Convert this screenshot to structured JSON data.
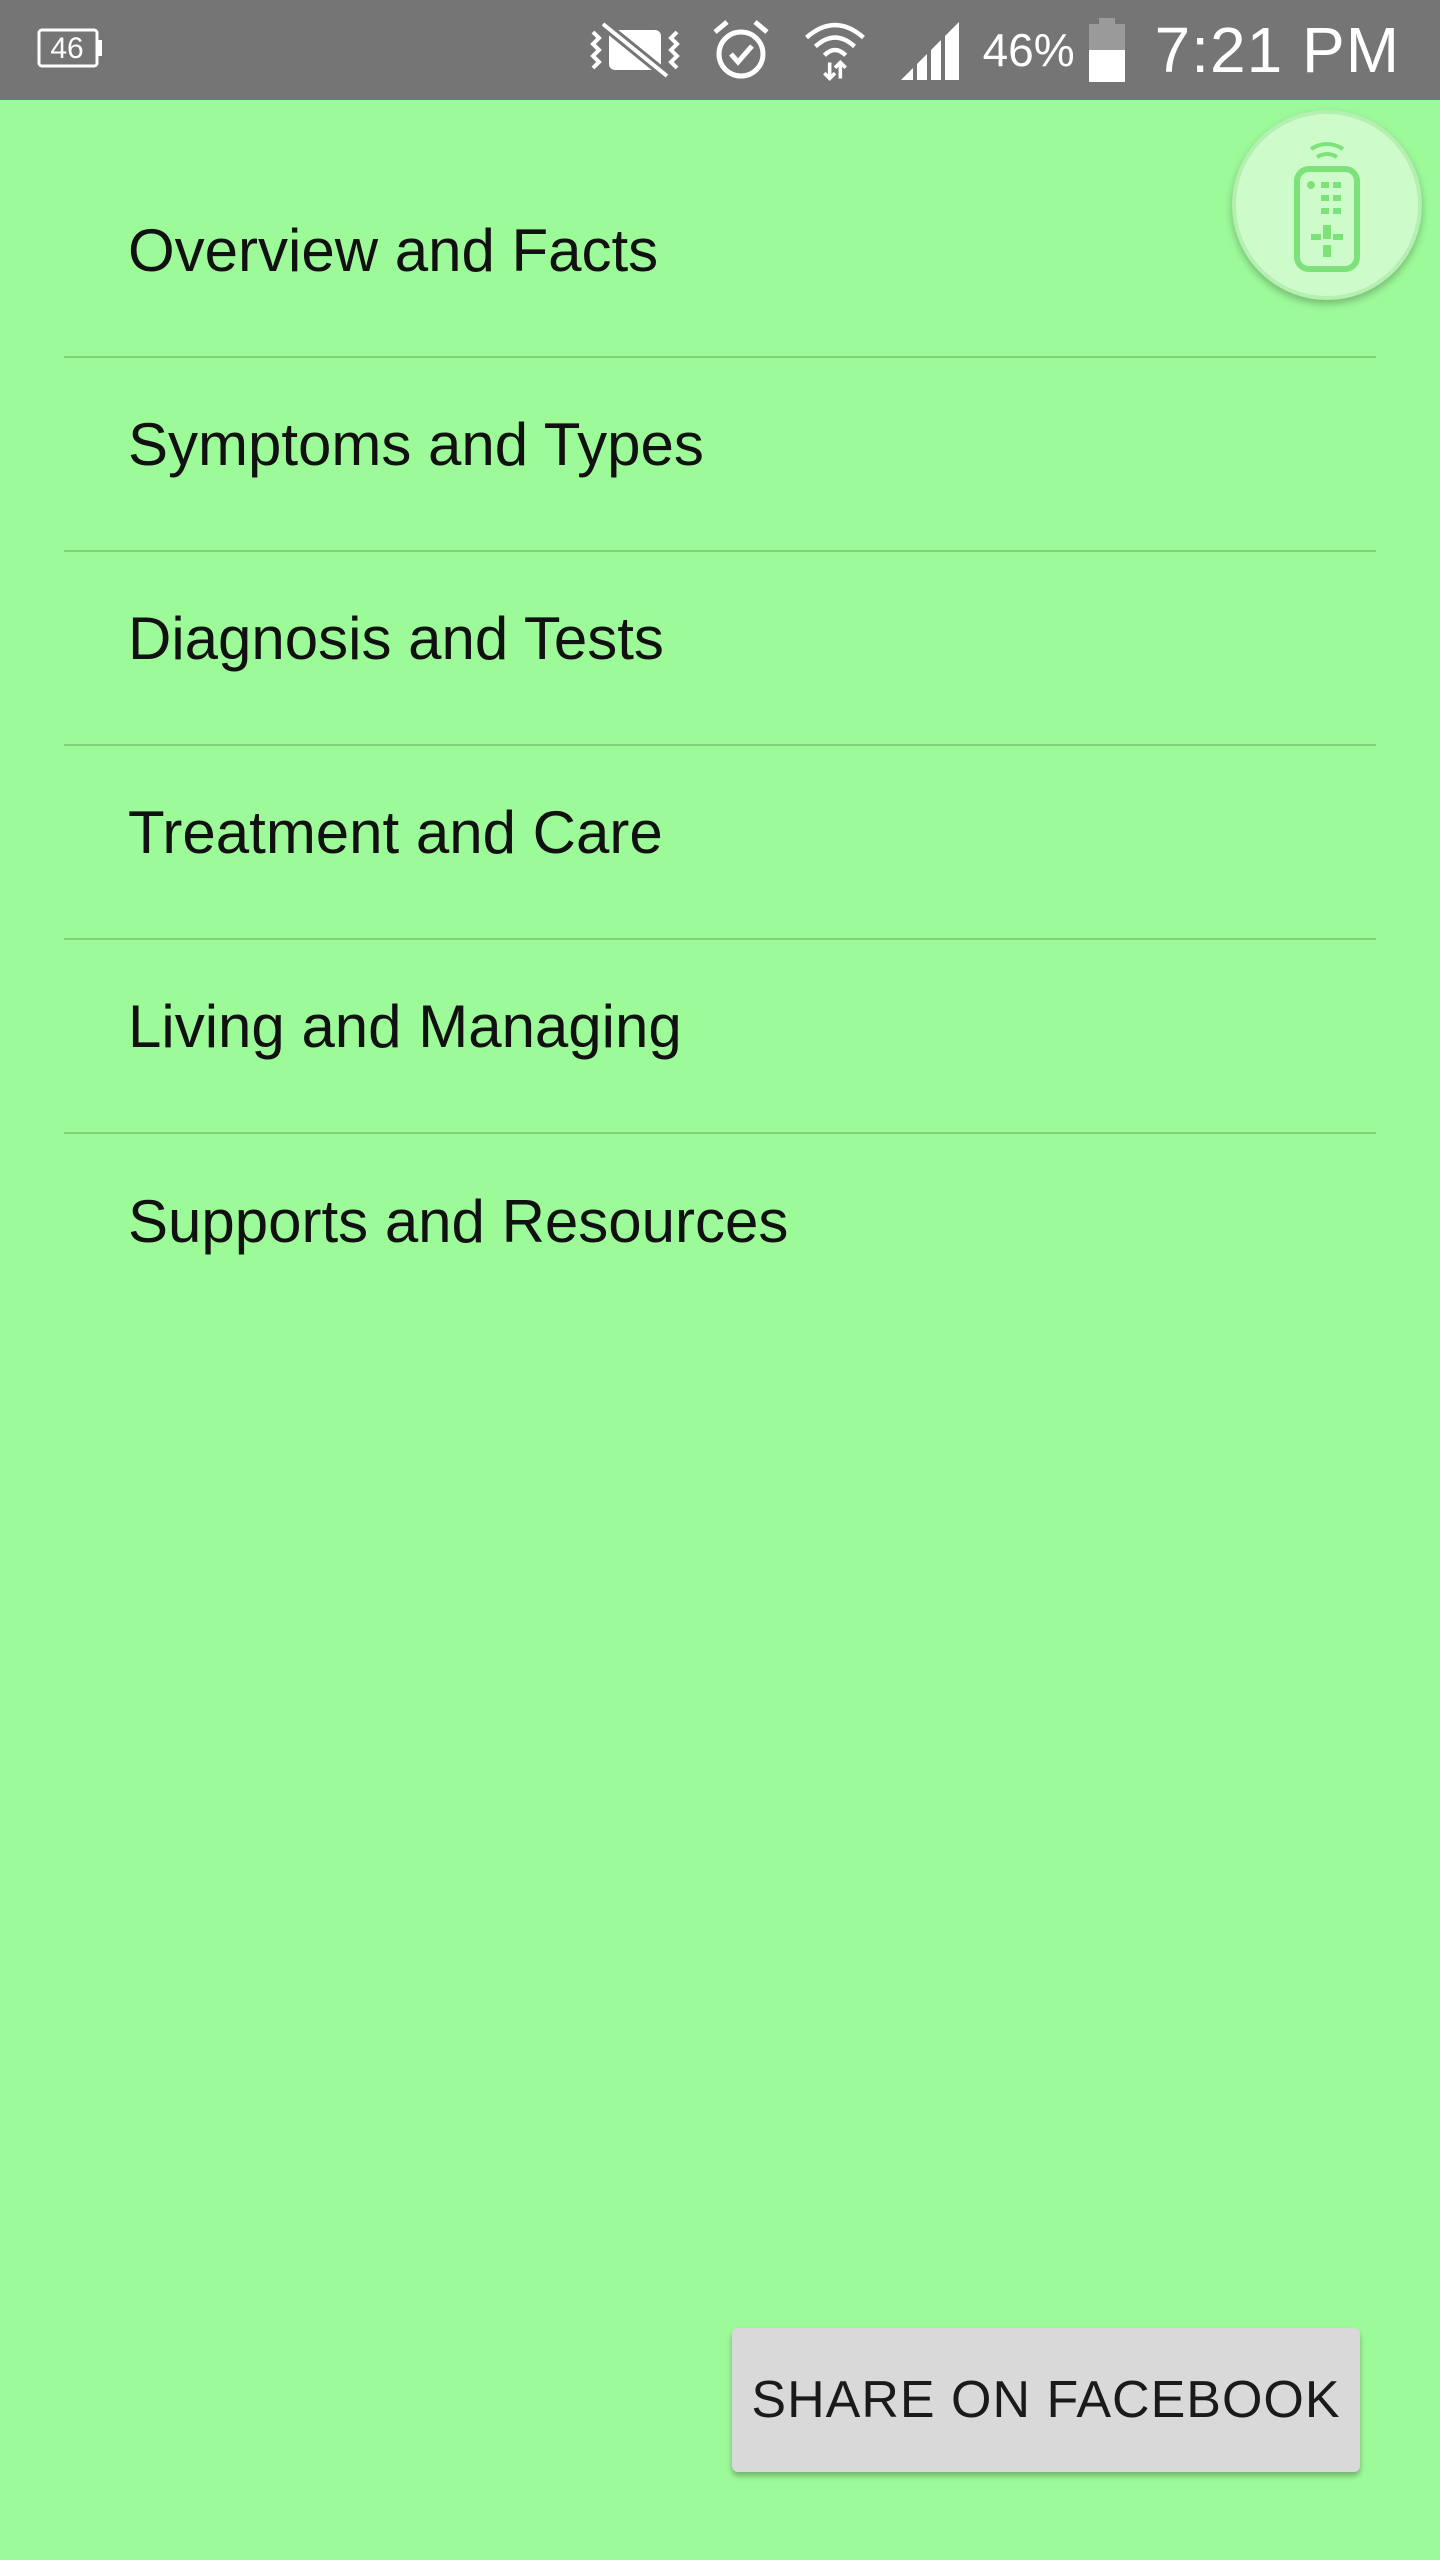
{
  "status_bar": {
    "left_badge": "46",
    "battery_percent": "46%",
    "time": "7:21 PM",
    "icons": [
      "notification-46-icon",
      "vibrate-off-icon",
      "alarm-icon",
      "wifi-icon",
      "signal-icon",
      "battery-icon"
    ]
  },
  "menu": {
    "items": [
      {
        "label": "Overview and Facts"
      },
      {
        "label": "Symptoms and Types"
      },
      {
        "label": "Diagnosis and Tests"
      },
      {
        "label": "Treatment and Care"
      },
      {
        "label": "Living and Managing"
      },
      {
        "label": "Supports and Resources"
      }
    ]
  },
  "fab": {
    "icon": "remote-control-icon"
  },
  "share": {
    "label": "SHARE ON FACEBOOK"
  },
  "colors": {
    "background": "#9dfa99",
    "status_bar": "#757575",
    "divider": "#7fd37c",
    "fab_fill": "#cdfcca",
    "fab_icon": "#7ee27a",
    "button": "#d9d9d9"
  }
}
